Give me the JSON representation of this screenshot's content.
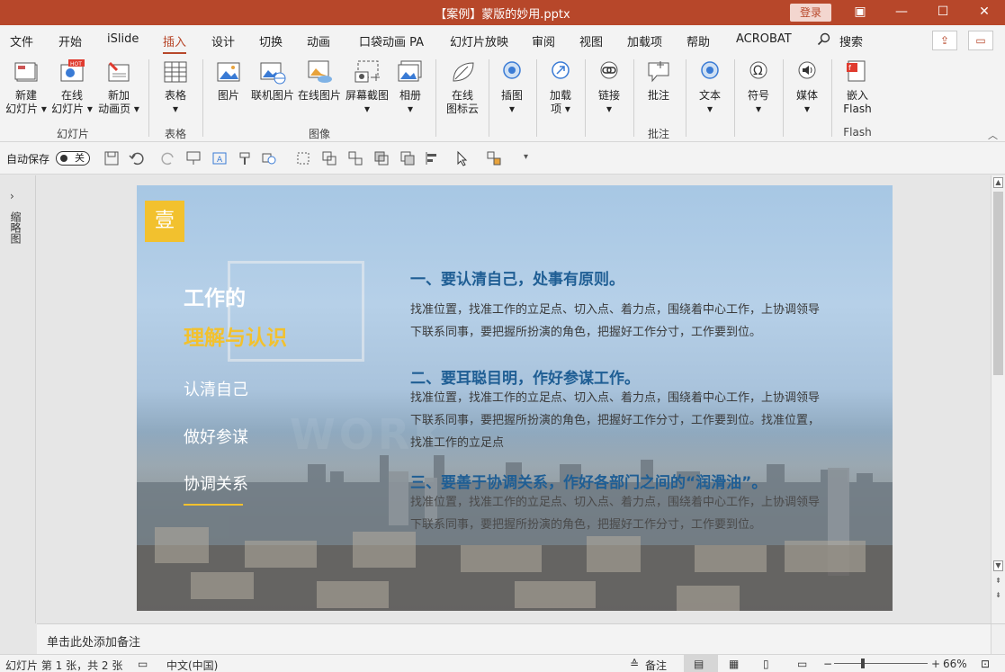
{
  "window": {
    "title": "【案例】蒙版的妙用.pptx",
    "login": "登录",
    "controls": [
      "▣",
      "—",
      "☐",
      "✕"
    ]
  },
  "menu": {
    "tabs": [
      "文件",
      "开始",
      "iSlide",
      "插入",
      "设计",
      "切换",
      "动画",
      "口袋动画 PA",
      "幻灯片放映",
      "审阅",
      "视图",
      "加载项",
      "帮助",
      "ACROBAT",
      "搜索"
    ],
    "active": "插入"
  },
  "ribbon": {
    "buttons": {
      "new_slide": "新建\n幻灯片 ▾",
      "online_slide": "在线\n幻灯片 ▾",
      "new_anim_page": "新加\n动画页 ▾",
      "table": "表格\n▾",
      "picture": "图片",
      "online_pic": "联机图片",
      "online_pic2": "在线图片",
      "screenshot": "屏幕截图\n▾",
      "album": "相册\n▾",
      "icon_cloud": "在线\n图标云",
      "illustration": "插图\n▾",
      "addins": "加载\n项 ▾",
      "link": "链接\n▾",
      "comment": "批注",
      "text": "文本\n▾",
      "symbol": "符号\n▾",
      "media": "媒体\n▾",
      "flash": "嵌入\nFlash"
    },
    "groups": {
      "slides": "幻灯片",
      "tables": "表格",
      "images": "图像",
      "comments": "批注",
      "flash": "Flash"
    }
  },
  "qat": {
    "autosave_label": "自动保存",
    "autosave_state": "关"
  },
  "thumbnail_panel": {
    "label": "缩略图",
    "expand": "›"
  },
  "slide": {
    "badge": "壹",
    "heading_white": "工作的",
    "heading_gold": "理解与认识",
    "nav": [
      "认清自己",
      "做好参谋",
      "协调关系"
    ],
    "watermark": "WORK",
    "sections": [
      {
        "title": "一、要认清自己，处事有原则。",
        "body": "找准位置，找准工作的立足点、切入点、着力点，围绕着中心工作，上协调领导下联系同事，要把握所扮演的角色，把握好工作分寸，工作要到位。"
      },
      {
        "title": "二、要耳聪目明，作好参谋工作。",
        "body": "找准位置，找准工作的立足点、切入点、着力点，围绕着中心工作，上协调领导下联系同事，要把握所扮演的角色，把握好工作分寸，工作要到位。找准位置，找准工作的立足点"
      },
      {
        "title": "三、要善于协调关系，作好各部门之间的“润滑油”。",
        "body": "找准位置，找准工作的立足点、切入点、着力点，围绕着中心工作，上协调领导下联系同事，要把握所扮演的角色，把握好工作分寸，工作要到位。"
      }
    ]
  },
  "notes": {
    "placeholder": "单击此处添加备注"
  },
  "status": {
    "slide_info": "幻灯片 第 1 张，共 2 张",
    "language": "中文(中国)",
    "notes_btn": "备注",
    "zoom": "66%"
  },
  "colors": {
    "accent": "#b7472a",
    "gold": "#f2c12e",
    "heading_blue": "#1f5e94"
  }
}
